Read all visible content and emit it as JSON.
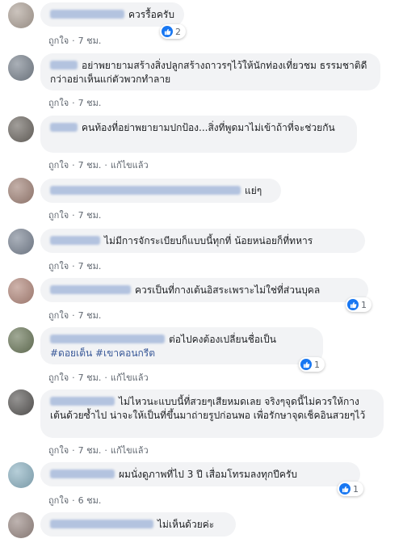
{
  "comments": [
    {
      "text": "ควรรื้อครับ",
      "meta": {
        "like": "ถูกใจ",
        "time": "7 ชม.",
        "edited": ""
      },
      "reactions": "2"
    },
    {
      "text": "อย่าพยายามสร้างสิ่งปลูกสร้างถาวรๆไว้ให้นักท่องเที่ยวชม ธรรมชาติดีกว่าอย่าเห็นแก่ตัวพวกทำลาย",
      "meta": {
        "like": "ถูกใจ",
        "time": "7 ชม.",
        "edited": ""
      },
      "reactions": ""
    },
    {
      "text": "คนท้องที่อย่าพยายามปกป้อง...สิ่งที่พูดมาไม่เข้าถ้าที่จะช่วยกัน",
      "meta": {
        "like": "ถูกใจ",
        "time": "7 ชม.",
        "edited": "แก้ไขแล้ว"
      },
      "reactions": ""
    },
    {
      "text": "แย่ๆ",
      "meta": {
        "like": "ถูกใจ",
        "time": "7 ชม.",
        "edited": ""
      },
      "reactions": ""
    },
    {
      "text": "ไม่มีการจักระเบียบก็แบบนี้ทุกที่ น้อยหน่อยก็ที่ทหาร",
      "meta": {
        "like": "ถูกใจ",
        "time": "7 ชม.",
        "edited": ""
      },
      "reactions": ""
    },
    {
      "text": "ควรเป็นที่กางเต้นอิสระเพราะไม่ใช่ที่ส่วนบุคล",
      "meta": {
        "like": "ถูกใจ",
        "time": "7 ชม.",
        "edited": ""
      },
      "reactions": "1"
    },
    {
      "text": "ต่อไปคงต้องเปลี่ยนชื่อเป็น",
      "hashtags": "#ดอยเต็น #เขาคอนกรีต",
      "meta": {
        "like": "ถูกใจ",
        "time": "7 ชม.",
        "edited": "แก้ไขแล้ว"
      },
      "reactions": "1"
    },
    {
      "text": "ไม่ไหวนะแบบนี้ที่สวยๆเสียหมดเลย จริงๆจุดนี้ไม่ควรให้กางเต้นด้วยซ้ำไป น่าจะให้เป็นที่ขึ้นมาถ่ายรูปก่อนพอ เพื่อรักษาจุดเช็คอินสวยๆไว้",
      "meta": {
        "like": "ถูกใจ",
        "time": "7 ชม.",
        "edited": "แก้ไขแล้ว"
      },
      "reactions": ""
    },
    {
      "text": "ผมนั่งดูภาพที่ไป 3 ปี เสื่อมโทรมลงทุกปีครับ",
      "meta": {
        "like": "ถูกใจ",
        "time": "6 ชม.",
        "edited": ""
      },
      "reactions": "1"
    },
    {
      "text": "ไม่เห็นด้วยค่ะ",
      "meta": {
        "like": "ถูกใจ",
        "time": "",
        "edited": ""
      },
      "reactions": ""
    }
  ],
  "separator": "·"
}
